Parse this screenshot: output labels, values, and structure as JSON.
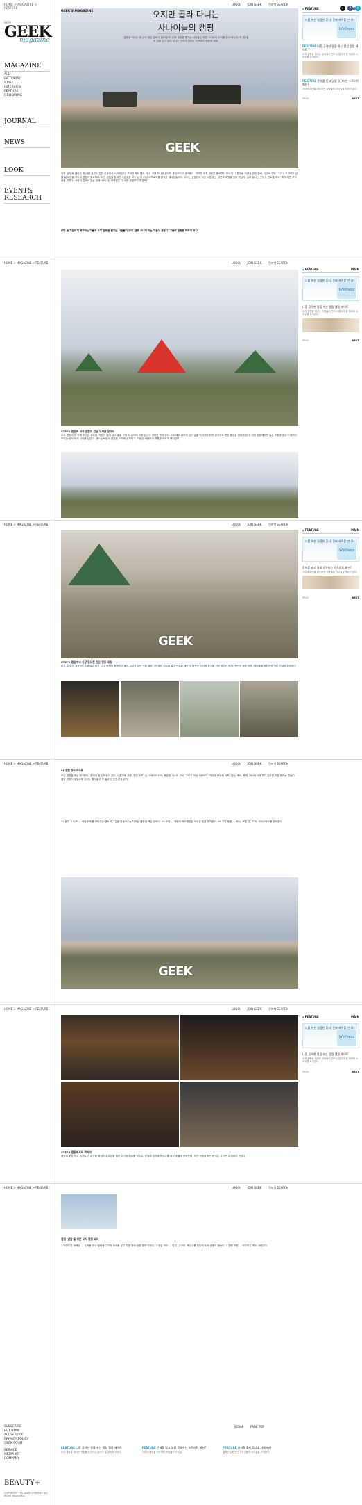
{
  "site": {
    "breadcrumb": "HOME > MAGAZINE > FEATURE",
    "logo_small": "BETA",
    "logo_main": "GEEK",
    "logo_script": "magazine",
    "watermark": "GEEK",
    "watermark_url": "www.geekmag.co.kr",
    "top_links": [
      "LOGIN",
      "JOIN GEEK",
      "진지백 SEARCH"
    ],
    "top_links_short": [
      "LOGIN",
      "JOIN GEEK",
      "SEARCH"
    ]
  },
  "sidebar": {
    "magazine": "MAGAZINE",
    "magazine_items": [
      "ALL",
      "PICTORIAL",
      "STYLE",
      "INTERVIEW",
      "FEATURE",
      "GROOMING"
    ],
    "journal": "JOURNAL",
    "news": "NEWS",
    "look": "LOOK",
    "event": "EVENT& RESEARCH",
    "footer_items": [
      "SUBSCRIBE",
      "BUY NOW",
      "ALL SERVICE",
      "PRIVACY POLICY",
      "GEEK POINT",
      "SERVICE",
      "MEDIA KIT",
      "COMPANY"
    ],
    "footer_logo": "BEAUTY+",
    "copyright": "COPYRIGHT THE GEEK COMPANY ALL RIGHT RESERVED"
  },
  "article": {
    "tag": "GEEK'S MAGAZINE",
    "title_line1": "오지만 골라 다니는",
    "title_line2": "사나이들의 캠핑",
    "lead": "캠핑을 떠나는 데 굳이 멋진 장비가 필요할까? 진짜 캠핑을 즐기는 사람들은 자연 그대로의 오지를 찾아 떠난다. 차 한 대에 짐을 싣고 길이 끝나는 곳까지 달리는 오프로드 캠핑의 세계.",
    "body1": "나의 첫 번째 캠핑은 한 여름 강원도 깊은 산골에서 시작되었다. 그때만 해도 텐트 하나, 코펠 하나만 있으면 충분하다고 생각했다. 하지만 오지 캠핑은 준비부터 다르다. 사륜구동 차량과 견인 장비, 식수와 연료, 그리고 무엇보다 길을 잃지 않을 지도와 경험이 필요하다. 이번 캠핑을 함께한 사람들은 모두 십 년 이상 오프로드를 즐겨온 베테랑들이다. 우리는 캠핑장이 아닌 이름 없는 강변과 초원을 찾아 떠났다. 길이 끝나는 곳에서 텐트를 치고, 해가 지면 모닥불을 피웠다. 사람의 흔적이 없는 곳에서 보내는 하룻밤은 그 어떤 호텔보다 특별하다.",
    "body1_quote": "보다 큰 자연에게 배우려는 이들과 오지 캠핑을 즐기는 사람들이 모여 '캠프 사나이'라는 이름이 생겼다. 그들의 캠핑을 따라가 보자.",
    "step1_cap": "STEP1 캠핑에 최적 온천이 있는 오지를 찾아라",
    "step1_body": "오지 캠핑의 첫 번째 조건은 장소다. 사람이 많지 않고 물을 구할 수 있으며 차량 접근이 가능한 곳이 좋다. 지도에도 나오지 않는 길을 따라가다 보면 생각지도 못한 풍경을 만나게 된다. 이번 캠핑에서는 넓은 초원과 호수가 내려다보이는 언덕 위에 자리를 잡았다. 텐트는 바람의 방향을 고려해 설치하고, 차량은 바람막이 역할을 하도록 배치한다.",
    "step2_cap": "STEP2 캠핑에서 가장 중요한 것은 텐트 세팅",
    "step2_body": "비가 온 뒤의 캠핑장은 진흙탕이 되기 쉽다. 바닥이 평평하고 물이 고이지 않는 곳을 골라 그라운드 시트를 깔고 텐트를 세운다. 타프는 식사와 휴식을 위한 공간이 되며, 랜턴과 캠핑 의자, 테이블을 배치하면 작은 거실이 완성된다.",
    "tips_title": "01 캠핑 장비 리스트",
    "tips_body": "오지 캠핑을 떠날 때 반드시 챙겨야 할 장비들이 있다. 사륜구동 차량, 견인 로프, 삽, 스페어타이어, 충분한 식수와 연료, 그리고 비상 식량이다. 여기에 텐트와 타프, 침낭, 매트, 랜턴, 버너와 코펠까지 갖추면 기본 준비는 끝난다. 캠핑 경험이 쌓일수록 장비는 줄어들고 꼭 필요한 것만 남게 된다.",
    "tips_body2": "02 텐트 & 타프 — 바람과 비를 막아주는 텐트와 그늘을 만들어주는 타프는 캠핑의 핵심 장비다. 03 조명 — 랜턴과 헤드랜턴은 어두운 밤을 밝혀준다. 04 주방 용품 — 버너, 코펠, 칼, 도마, 아이스박스를 준비한다.",
    "step3_cap": "STEP3 캠핑에서의 먹거리",
    "step3_body": "캠핑의 꽃은 역시 먹거리다. 모닥불 위에 더치오븐을 올려 고기와 채소를 익히고, 호일에 감자와 옥수수를 싸서 숯불에 묻어둔다. 자연 속에서 먹는 음식은 그 어떤 요리보다 맛있다.",
    "final_title": "캠핑 '냠냠'을 위한 오지 캠핑 요리",
    "final_body": "1 더치오븐 바베큐 — 두꺼운 무쇠 냄비에 고기와 채소를 넣고 뚜껑 위에 숯을 올려 익힌다. 2 호일 구이 — 감자, 고구마, 옥수수를 호일에 싸서 숯불에 묻는다. 3 캠핑 라면 — 마지막은 역시 라면이다.",
    "share": "SCRAP",
    "page_top": "PAGE TOP"
  },
  "right_column": {
    "feature": "FEATURE",
    "main": "MAIN",
    "ad_text": "나를 위한 달콤한 휴식, 진짜 제주를 만나다",
    "ad_badge": "Wellness",
    "items": [
      {
        "tag": "FEATURE",
        "title": "나혼 공략한 알을 쉬는 캠핑 캠핑 게이트",
        "desc": "오지 캠핑을 떠나는 사람들이 반드시 알아야 할 장비와 노하우를 소개한다."
      },
      {
        "tag": "FEATURE",
        "title": "문체를 알고 달을 공유하는 스트리트 패션?",
        "desc": "거리의 패션을 리드하는 사람들의 스타일을 따라가 본다."
      }
    ],
    "prev": "PREV",
    "next": "NEXT"
  },
  "related": [
    {
      "tag": "FEATURE",
      "title": "나혼 공략한 알을 쉬는 캠핑 캠핑 게이트",
      "desc": "오지 캠핑을 떠나는 사람들이 반드시 알아야 할 장비와 노하우."
    },
    {
      "tag": "FEATURE",
      "title": "문체를 알고 달을 공유하는 스트리트 패션?",
      "desc": "거리의 패션을 리드하는 사람들의 스타일."
    },
    {
      "tag": "FEATURE",
      "title": "지하철 출퇴 GULL 사내 패션",
      "desc": "출퇴근길에 만난 직장인들의 스타일을 소개한다."
    }
  ],
  "colors": {
    "accent": "#1aa1d5",
    "facebook": "#3b5998",
    "dark": "#111111"
  }
}
